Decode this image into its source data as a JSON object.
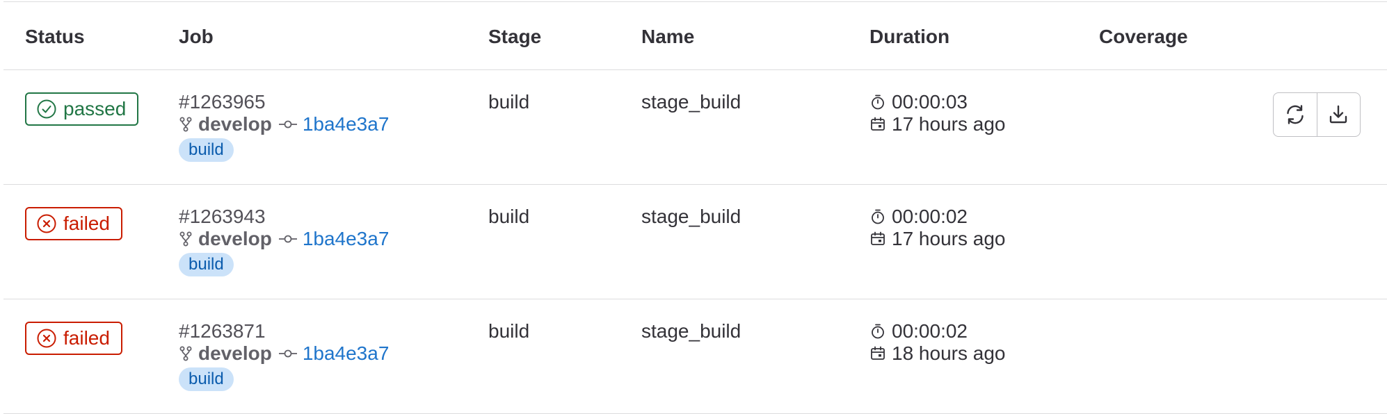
{
  "columns": {
    "status": "Status",
    "job": "Job",
    "stage": "Stage",
    "name": "Name",
    "duration": "Duration",
    "coverage": "Coverage"
  },
  "colors": {
    "passed": "#217645",
    "failed": "#c91c00",
    "link": "#1f75cb",
    "pill_bg": "#cbe2f9",
    "pill_text": "#0b5cad"
  },
  "rows": [
    {
      "status": "passed",
      "status_icon": "check-circle-icon",
      "job_id": "#1263965",
      "branch": "develop",
      "commit": "1ba4e3a7",
      "stage_tag": "build",
      "stage": "build",
      "name": "stage_build",
      "duration": "00:00:03",
      "finished": "17 hours ago",
      "actions": [
        "retry-icon",
        "download-icon"
      ]
    },
    {
      "status": "failed",
      "status_icon": "x-circle-icon",
      "job_id": "#1263943",
      "branch": "develop",
      "commit": "1ba4e3a7",
      "stage_tag": "build",
      "stage": "build",
      "name": "stage_build",
      "duration": "00:00:02",
      "finished": "17 hours ago"
    },
    {
      "status": "failed",
      "status_icon": "x-circle-icon",
      "job_id": "#1263871",
      "branch": "develop",
      "commit": "1ba4e3a7",
      "stage_tag": "build",
      "stage": "build",
      "name": "stage_build",
      "duration": "00:00:02",
      "finished": "18 hours ago"
    }
  ]
}
